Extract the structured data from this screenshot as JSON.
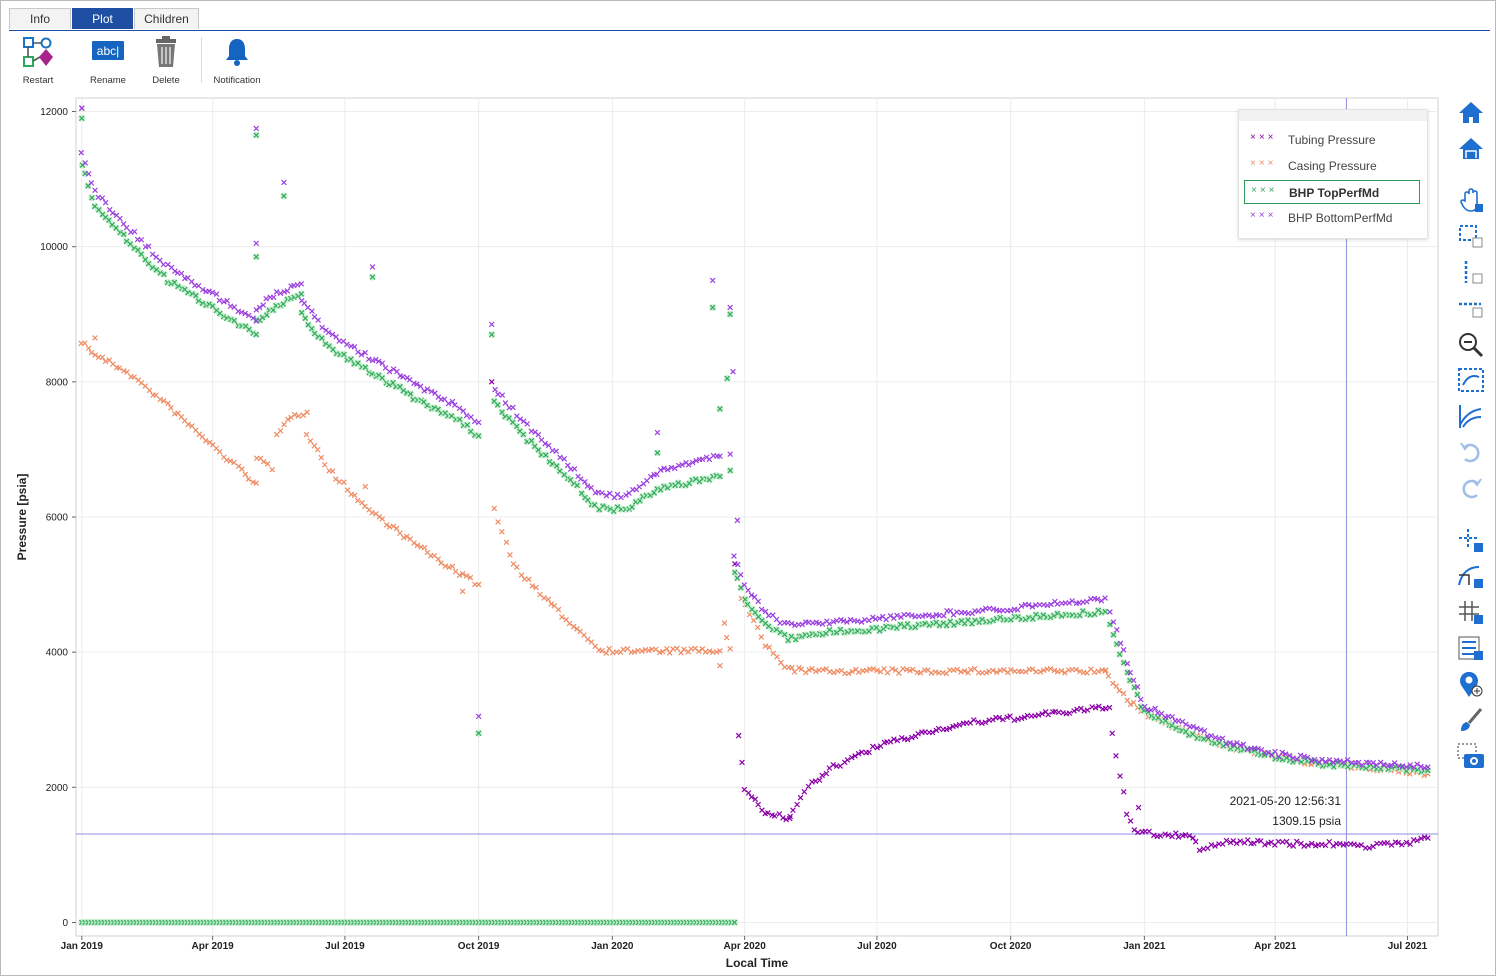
{
  "tabs": [
    {
      "label": "Info",
      "active": false
    },
    {
      "label": "Plot",
      "active": true
    },
    {
      "label": "Children",
      "active": false
    }
  ],
  "toolbar": {
    "restart_label": "Restart",
    "rename_label": "Rename",
    "rename_icon_text": "abc|",
    "delete_label": "Delete",
    "notification_label": "Notification"
  },
  "side_tools": [
    "home-icon",
    "home-reset-icon",
    "pan-hand-icon",
    "box-zoom-icon",
    "x-zoom-icon",
    "y-zoom-icon",
    "zoom-out-icon",
    "autoscale-icon",
    "curve-icon",
    "undo-icon",
    "redo-icon",
    "crosshair-icon",
    "curve-tool-icon",
    "grid-icon",
    "legend-icon",
    "pin-add-icon",
    "brush-icon",
    "camera-icon"
  ],
  "colors": {
    "tubing": "#8a00a8",
    "casing": "#ef8b62",
    "bhp_top": "#2ea85a",
    "bhp_top_glow": "#c9f0cf",
    "bhp_bottom": "#9a3ee0",
    "tab_active": "#1f4fa3",
    "toolbar_blue": "#1565c0",
    "crosshair": "#8d8de0"
  },
  "tooltip": {
    "time": "2021-05-20 12:56:31",
    "value": "1309.15 psia"
  },
  "chart_data": {
    "type": "scatter",
    "xlabel": "Local Time",
    "ylabel": "Pressure [psia]",
    "ylim": [
      -200,
      12200
    ],
    "xlim": [
      "2018-12-28",
      "2021-07-22"
    ],
    "yticks": [
      0,
      2000,
      4000,
      6000,
      8000,
      10000,
      12000
    ],
    "xticks": [
      {
        "date": "2019-01-01",
        "label": "Jan 2019"
      },
      {
        "date": "2019-04-01",
        "label": "Apr 2019"
      },
      {
        "date": "2019-07-01",
        "label": "Jul 2019"
      },
      {
        "date": "2019-10-01",
        "label": "Oct 2019"
      },
      {
        "date": "2020-01-01",
        "label": "Jan 2020"
      },
      {
        "date": "2020-04-01",
        "label": "Apr 2020"
      },
      {
        "date": "2020-07-01",
        "label": "Jul 2020"
      },
      {
        "date": "2020-10-01",
        "label": "Oct 2020"
      },
      {
        "date": "2021-01-01",
        "label": "Jan 2021"
      },
      {
        "date": "2021-04-01",
        "label": "Apr 2021"
      },
      {
        "date": "2021-07-01",
        "label": "Jul 2021"
      }
    ],
    "grid": true,
    "legend_position": "top-right",
    "crosshair": {
      "date": "2021-05-20",
      "value": 1309.15
    },
    "marker": "x",
    "series": [
      {
        "name": "Tubing Pressure",
        "key": "tubing",
        "segments": [
          {
            "points": [
              [
                "2019-01-01",
                0
              ],
              [
                "2020-03-25",
                0
              ]
            ]
          },
          {
            "points": [
              [
                "2020-03-25",
                5300
              ],
              [
                "2020-03-28",
                2800
              ],
              [
                "2020-04-01",
                2000
              ],
              [
                "2020-04-08",
                1800
              ],
              [
                "2020-04-15",
                1620
              ],
              [
                "2020-04-22",
                1580
              ],
              [
                "2020-05-02",
                1540
              ]
            ]
          },
          {
            "points": [
              [
                "2020-05-02",
                1600
              ],
              [
                "2020-05-15",
                2000
              ],
              [
                "2020-06-01",
                2300
              ],
              [
                "2020-07-01",
                2600
              ],
              [
                "2020-08-01",
                2800
              ],
              [
                "2020-09-01",
                2950
              ],
              [
                "2020-10-01",
                3020
              ],
              [
                "2020-11-01",
                3100
              ],
              [
                "2020-12-08",
                3180
              ]
            ]
          },
          {
            "points": [
              [
                "2020-12-10",
                2800
              ],
              [
                "2020-12-15",
                2200
              ],
              [
                "2020-12-20",
                1600
              ],
              [
                "2020-12-25",
                1350
              ],
              [
                "2021-01-15",
                1280
              ],
              [
                "2021-02-01",
                1300
              ],
              [
                "2021-02-08",
                1100
              ],
              [
                "2021-03-01",
                1200
              ],
              [
                "2021-04-01",
                1180
              ],
              [
                "2021-05-01",
                1150
              ],
              [
                "2021-05-25",
                1180
              ],
              [
                "2021-06-05",
                1120
              ],
              [
                "2021-07-05",
                1200
              ],
              [
                "2021-07-15",
                1250
              ]
            ]
          }
        ],
        "outliers": [
          [
            "2019-01-01",
            12050
          ],
          [
            "2019-10-10",
            8000
          ],
          [
            "2020-12-28",
            1700
          ]
        ]
      },
      {
        "name": "Casing Pressure",
        "key": "casing",
        "segments": [
          {
            "points": [
              [
                "2019-01-01",
                8600
              ],
              [
                "2019-01-10",
                8400
              ],
              [
                "2019-02-01",
                8150
              ],
              [
                "2019-03-01",
                7650
              ],
              [
                "2019-04-01",
                7050
              ],
              [
                "2019-05-01",
                6500
              ]
            ]
          },
          {
            "points": [
              [
                "2019-05-01",
                6900
              ],
              [
                "2019-05-12",
                6700
              ]
            ]
          },
          {
            "points": [
              [
                "2019-05-15",
                7200
              ],
              [
                "2019-05-25",
                7500
              ],
              [
                "2019-06-05",
                7550
              ]
            ]
          },
          {
            "points": [
              [
                "2019-06-05",
                7250
              ],
              [
                "2019-06-20",
                6700
              ],
              [
                "2019-07-15",
                6150
              ],
              [
                "2019-08-15",
                5650
              ],
              [
                "2019-09-15",
                5200
              ],
              [
                "2019-10-01",
                5000
              ]
            ]
          },
          {
            "points": [
              [
                "2019-10-12",
                6100
              ],
              [
                "2019-10-25",
                5300
              ],
              [
                "2019-11-15",
                4800
              ],
              [
                "2019-12-10",
                4300
              ],
              [
                "2019-12-25",
                4020
              ],
              [
                "2020-03-15",
                4020
              ]
            ]
          },
          {
            "points": [
              [
                "2020-03-18",
                4400
              ],
              [
                "2020-03-22",
                4050
              ]
            ]
          },
          {
            "points": [
              [
                "2020-03-30",
                4800
              ],
              [
                "2020-04-15",
                4100
              ],
              [
                "2020-05-01",
                3750
              ],
              [
                "2020-05-15",
                3720
              ],
              [
                "2020-12-05",
                3720
              ]
            ]
          },
          {
            "points": [
              [
                "2020-12-05",
                3700
              ],
              [
                "2020-12-20",
                3300
              ],
              [
                "2021-01-01",
                3100
              ],
              [
                "2021-02-01",
                2800
              ],
              [
                "2021-03-01",
                2600
              ],
              [
                "2021-04-01",
                2450
              ],
              [
                "2021-05-01",
                2350
              ],
              [
                "2021-07-15",
                2200
              ]
            ]
          }
        ],
        "outliers": [
          [
            "2019-01-10",
            8650
          ],
          [
            "2019-07-15",
            6450
          ],
          [
            "2019-09-20",
            4900
          ],
          [
            "2020-03-15",
            3800
          ]
        ]
      },
      {
        "name": "BHP TopPerfMd",
        "key": "bhp_top",
        "selected": true,
        "segments": [
          {
            "points": [
              [
                "2019-01-01",
                0
              ],
              [
                "2020-03-25",
                0
              ]
            ]
          },
          {
            "points": [
              [
                "2019-01-01",
                11200
              ],
              [
                "2019-01-10",
                10600
              ],
              [
                "2019-02-01",
                10100
              ],
              [
                "2019-03-01",
                9500
              ],
              [
                "2019-04-01",
                9100
              ],
              [
                "2019-05-01",
                8700
              ]
            ]
          },
          {
            "points": [
              [
                "2019-05-01",
                8900
              ],
              [
                "2019-05-15",
                9100
              ],
              [
                "2019-06-01",
                9300
              ]
            ]
          },
          {
            "points": [
              [
                "2019-06-01",
                9000
              ],
              [
                "2019-06-20",
                8500
              ],
              [
                "2019-07-15",
                8200
              ],
              [
                "2019-08-15",
                7800
              ],
              [
                "2019-09-15",
                7450
              ],
              [
                "2019-10-01",
                7200
              ]
            ]
          },
          {
            "points": [
              [
                "2019-10-12",
                7700
              ],
              [
                "2019-11-01",
                7200
              ],
              [
                "2019-12-01",
                6600
              ],
              [
                "2019-12-20",
                6150
              ],
              [
                "2020-01-10",
                6100
              ],
              [
                "2020-02-01",
                6400
              ],
              [
                "2020-03-01",
                6550
              ],
              [
                "2020-03-15",
                6600
              ]
            ]
          },
          {
            "points": [
              [
                "2020-03-22",
                6700
              ],
              [
                "2020-03-25",
                5200
              ],
              [
                "2020-04-01",
                4800
              ],
              [
                "2020-04-15",
                4400
              ],
              [
                "2020-05-01",
                4200
              ],
              [
                "2020-06-01",
                4300
              ],
              [
                "2020-08-01",
                4400
              ],
              [
                "2020-10-01",
                4500
              ],
              [
                "2020-12-05",
                4600
              ]
            ]
          },
          {
            "points": [
              [
                "2020-12-08",
                4400
              ],
              [
                "2020-12-20",
                3700
              ],
              [
                "2021-01-01",
                3100
              ],
              [
                "2021-02-01",
                2800
              ],
              [
                "2021-03-01",
                2600
              ],
              [
                "2021-04-01",
                2450
              ],
              [
                "2021-05-01",
                2350
              ],
              [
                "2021-07-15",
                2250
              ]
            ]
          }
        ],
        "outliers": [
          [
            "2019-01-01",
            11900
          ],
          [
            "2019-05-01",
            9850
          ],
          [
            "2019-05-01",
            11650
          ],
          [
            "2019-05-20",
            10750
          ],
          [
            "2019-07-20",
            9550
          ],
          [
            "2019-10-01",
            2800
          ],
          [
            "2019-10-10",
            8700
          ],
          [
            "2020-02-01",
            6950
          ],
          [
            "2020-03-10",
            9100
          ],
          [
            "2020-03-15",
            7600
          ],
          [
            "2020-03-20",
            8050
          ],
          [
            "2020-03-22",
            9000
          ]
        ]
      },
      {
        "name": "BHP BottomPerfMd",
        "key": "bhp_bottom",
        "segments": [
          {
            "points": [
              [
                "2019-01-01",
                11400
              ],
              [
                "2019-01-10",
                10800
              ],
              [
                "2019-02-01",
                10300
              ],
              [
                "2019-03-01",
                9700
              ],
              [
                "2019-04-01",
                9300
              ],
              [
                "2019-05-01",
                8900
              ]
            ]
          },
          {
            "points": [
              [
                "2019-05-01",
                9100
              ],
              [
                "2019-05-15",
                9300
              ],
              [
                "2019-06-01",
                9450
              ]
            ]
          },
          {
            "points": [
              [
                "2019-06-01",
                9200
              ],
              [
                "2019-06-20",
                8700
              ],
              [
                "2019-07-15",
                8400
              ],
              [
                "2019-08-15",
                8000
              ],
              [
                "2019-09-15",
                7650
              ],
              [
                "2019-10-01",
                7400
              ]
            ]
          },
          {
            "points": [
              [
                "2019-10-12",
                7900
              ],
              [
                "2019-11-01",
                7400
              ],
              [
                "2019-12-01",
                6800
              ],
              [
                "2019-12-20",
                6350
              ],
              [
                "2020-01-10",
                6300
              ],
              [
                "2020-02-01",
                6650
              ],
              [
                "2020-03-01",
                6850
              ],
              [
                "2020-03-15",
                6900
              ]
            ]
          },
          {
            "points": [
              [
                "2020-03-22",
                6950
              ],
              [
                "2020-03-25",
                5400
              ],
              [
                "2020-04-01",
                5000
              ],
              [
                "2020-04-15",
                4600
              ],
              [
                "2020-05-01",
                4400
              ],
              [
                "2020-06-01",
                4450
              ],
              [
                "2020-08-01",
                4550
              ],
              [
                "2020-10-01",
                4650
              ],
              [
                "2020-12-05",
                4800
              ]
            ]
          },
          {
            "points": [
              [
                "2020-12-08",
                4600
              ],
              [
                "2020-12-20",
                3850
              ],
              [
                "2021-01-01",
                3200
              ],
              [
                "2021-02-01",
                2900
              ],
              [
                "2021-03-01",
                2650
              ],
              [
                "2021-04-01",
                2500
              ],
              [
                "2021-05-01",
                2400
              ],
              [
                "2021-07-15",
                2300
              ]
            ]
          }
        ],
        "outliers": [
          [
            "2019-01-01",
            12050
          ],
          [
            "2019-05-01",
            10050
          ],
          [
            "2019-05-01",
            11750
          ],
          [
            "2019-05-20",
            10950
          ],
          [
            "2019-07-20",
            9700
          ],
          [
            "2019-10-01",
            3050
          ],
          [
            "2019-10-10",
            8850
          ],
          [
            "2020-02-01",
            7250
          ],
          [
            "2020-03-10",
            9500
          ],
          [
            "2020-03-22",
            9100
          ],
          [
            "2020-03-24",
            8150
          ],
          [
            "2020-03-27",
            5950
          ]
        ]
      }
    ]
  }
}
